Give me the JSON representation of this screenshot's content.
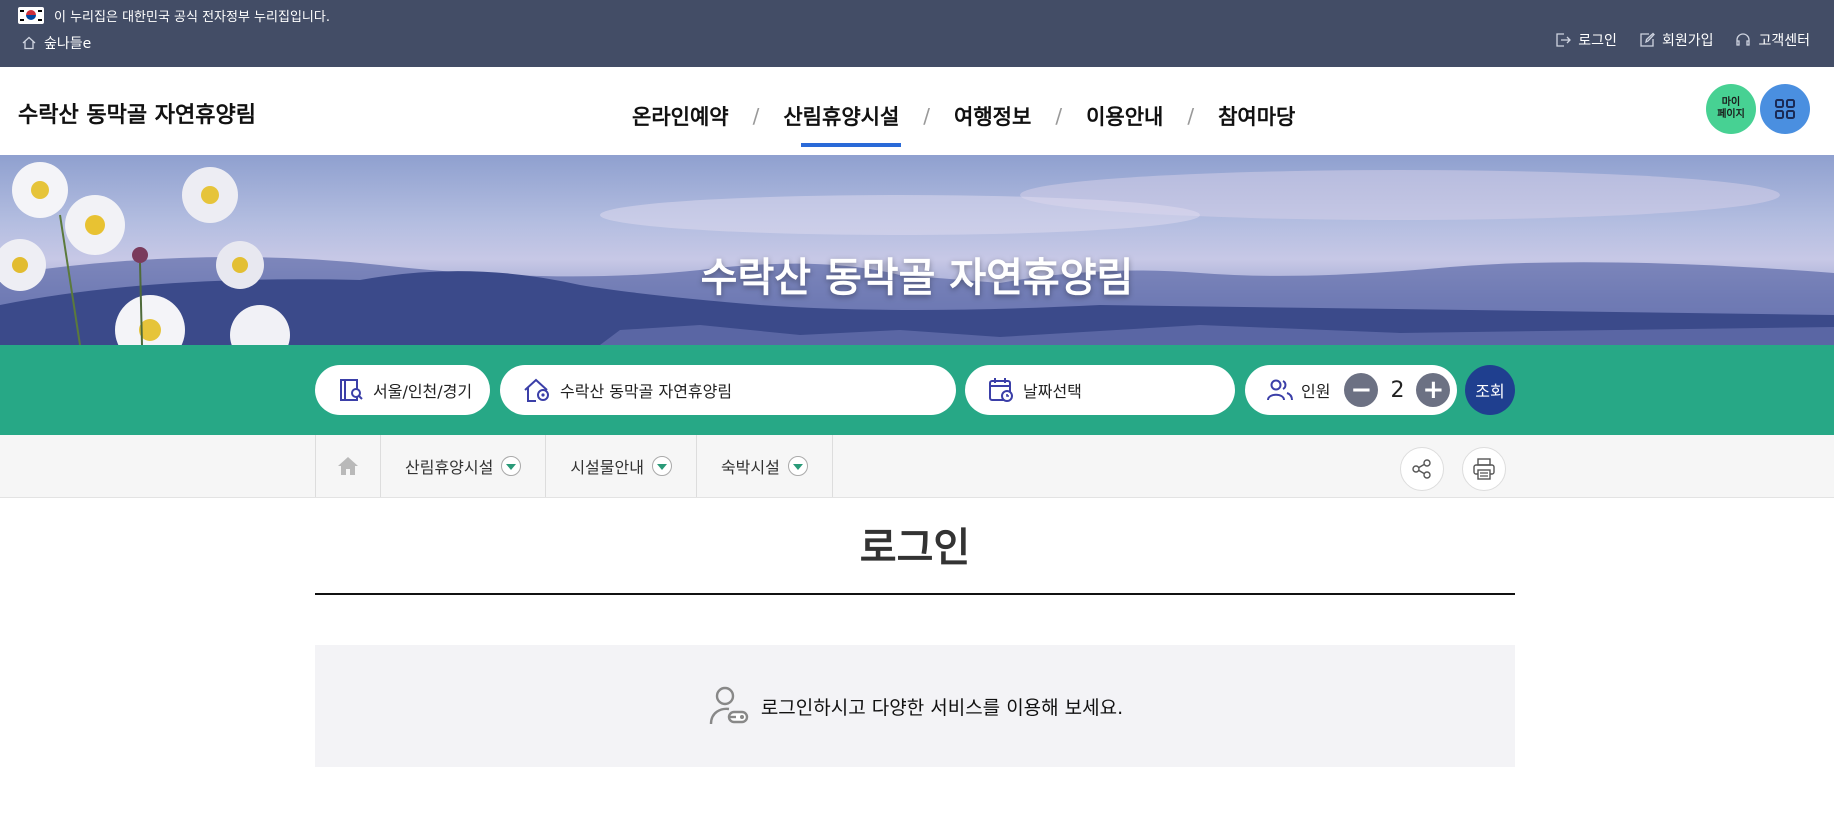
{
  "gov": {
    "notice": "이 누리집은 대한민국 공식 전자정부 누리집입니다.",
    "home_label": "숲나들e"
  },
  "util": {
    "login": "로그인",
    "signup": "회원가입",
    "support": "고객센터"
  },
  "site": {
    "title": "수락산 동막골 자연휴양림"
  },
  "gnb": {
    "items": [
      "온라인예약",
      "산림휴양시설",
      "여행정보",
      "이용안내",
      "참여마당"
    ],
    "separator": "/",
    "active_index": 1,
    "active_color": "#2a6ad8"
  },
  "header_buttons": {
    "mypage": "마이\n페이지",
    "mypage_line1": "마이",
    "mypage_line2": "페이지",
    "allmenu_icon": "grid-icon"
  },
  "banner": {
    "title": "수락산 동막골 자연휴양림"
  },
  "search": {
    "region": "서울/인천/경기",
    "facility": "수락산 동막골 자연휴양림",
    "date_placeholder": "날짜선택",
    "people_label": "인원",
    "people_count": "2",
    "minus": "−",
    "plus": "+",
    "submit": "조회",
    "bar_color": "#27a886"
  },
  "location": {
    "items": [
      "산림휴양시설",
      "시설물안내",
      "숙박시설"
    ]
  },
  "page": {
    "title": "로그인",
    "notice": "로그인하시고 다양한 서비스를 이용해 보세요."
  }
}
